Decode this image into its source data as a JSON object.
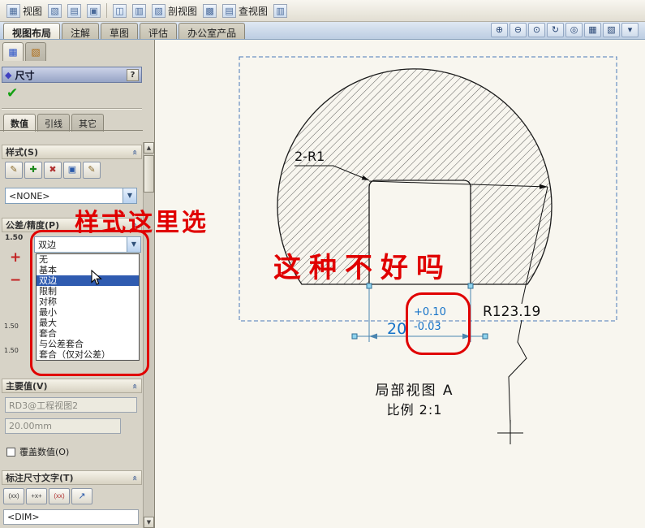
{
  "top_toolbar": {
    "button_labels": [
      "视图",
      "剖视图",
      "查视图"
    ]
  },
  "command_tabs": {
    "items": [
      "视图布局",
      "注解",
      "草图",
      "评估",
      "办公室产品"
    ]
  },
  "property_manager": {
    "title": "尺寸",
    "help": "?",
    "ok": "✔",
    "value_tabs": [
      "数值",
      "引线",
      "其它"
    ],
    "style_group": {
      "title": "样式(S)",
      "dropdown_value": "<NONE>"
    },
    "tolerance_group": {
      "title": "公差/精度(P)",
      "combo_value": "双边",
      "options": [
        "无",
        "基本",
        "双边",
        "限制",
        "对称",
        "最小",
        "最大",
        "套合",
        "与公差套合",
        "套合（仅对公差）"
      ],
      "side_labels": [
        "1.50",
        "+",
        "−",
        "1.50",
        "1.50"
      ]
    },
    "primary_group": {
      "title": "主要值(V)",
      "name_value": "RD3@工程视图2",
      "dim_value": "20.00mm",
      "override_label": "覆盖数值(O)"
    },
    "dim_text_group": {
      "title": "标注尺寸文字(T)",
      "buttons": [
        "(xx)",
        "+x+",
        "(xx)",
        "↗"
      ],
      "field_value": "<DIM>"
    }
  },
  "drawing": {
    "fillet_label": "2-R1",
    "dim_value": "20",
    "tol_upper": "+0.10",
    "tol_lower": "-0.03",
    "radius_label": "R123.19",
    "caption_line1": "局部视图 A",
    "caption_line2": "比例 2:1"
  },
  "annotations": {
    "style_note": "样式这里选",
    "tolerance_note": "这种不好吗"
  },
  "icons": {
    "pm_tab1": "▦",
    "pm_tab2": "▧",
    "header_diamond": "◆",
    "chevron": "«",
    "combo_arrow": "▼",
    "scroll_up": "▲",
    "scroll_down": "▼",
    "splitter_left": "◀",
    "splitter_right": "▶",
    "style_buttons": [
      "✎",
      "✚",
      "✖",
      "▣",
      "✎"
    ],
    "dim_text_buttons_note": "leader-display-buttons",
    "view_toolbar": [
      "⊕",
      "⊖",
      "⊙",
      "↻",
      "◎",
      "▦",
      "▧",
      "▾"
    ],
    "top_glyphs": [
      "▦",
      "▧",
      "▤",
      "▣",
      "◫",
      "▥",
      "▨",
      "▩"
    ]
  },
  "colors": {
    "annotation_red": "#e00000",
    "dimension_blue": "#1673c8",
    "selection_blue": "#2f5bb0"
  }
}
